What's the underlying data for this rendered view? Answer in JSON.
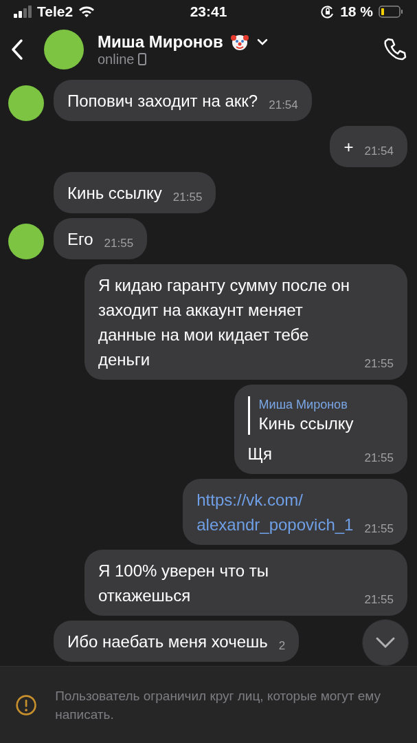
{
  "status_bar": {
    "carrier": "Tele2",
    "time": "23:41",
    "battery": "18 %"
  },
  "header": {
    "name": "Миша Миронов",
    "status": "online"
  },
  "messages": [
    {
      "kind": "text",
      "outgoing": false,
      "avatar": true,
      "text": "Попович заходит на акк?",
      "time": "21:54"
    },
    {
      "kind": "text",
      "outgoing": true,
      "avatar": false,
      "text": "+",
      "time": "21:54"
    },
    {
      "kind": "text",
      "outgoing": false,
      "avatar": false,
      "text": "Кинь ссылку",
      "time": "21:55"
    },
    {
      "kind": "text",
      "outgoing": false,
      "avatar": true,
      "text": "Его",
      "time": "21:55"
    },
    {
      "kind": "text",
      "outgoing": true,
      "avatar": false,
      "text": "Я кидаю гаранту сумму после он заходит на аккаунт меняет данные на мои кидает тебе деньги",
      "time": "21:55"
    },
    {
      "kind": "reply",
      "outgoing": true,
      "avatar": false,
      "quote_author": "Миша Миронов",
      "quote_text": "Кинь ссылку",
      "text": "Щя",
      "time": "21:55"
    },
    {
      "kind": "link",
      "outgoing": true,
      "avatar": false,
      "text": "https://vk.com/ alexandr_popovich_1",
      "time": "21:55"
    },
    {
      "kind": "text",
      "outgoing": true,
      "avatar": false,
      "text": "Я 100% уверен что ты откажешься",
      "time": "21:55"
    },
    {
      "kind": "text",
      "outgoing": false,
      "avatar": false,
      "text": "Ибо наебать меня хочешь",
      "time": "2"
    }
  ],
  "notice": {
    "text": "Пользователь ограничил круг лиц, которые могут ему написать."
  }
}
